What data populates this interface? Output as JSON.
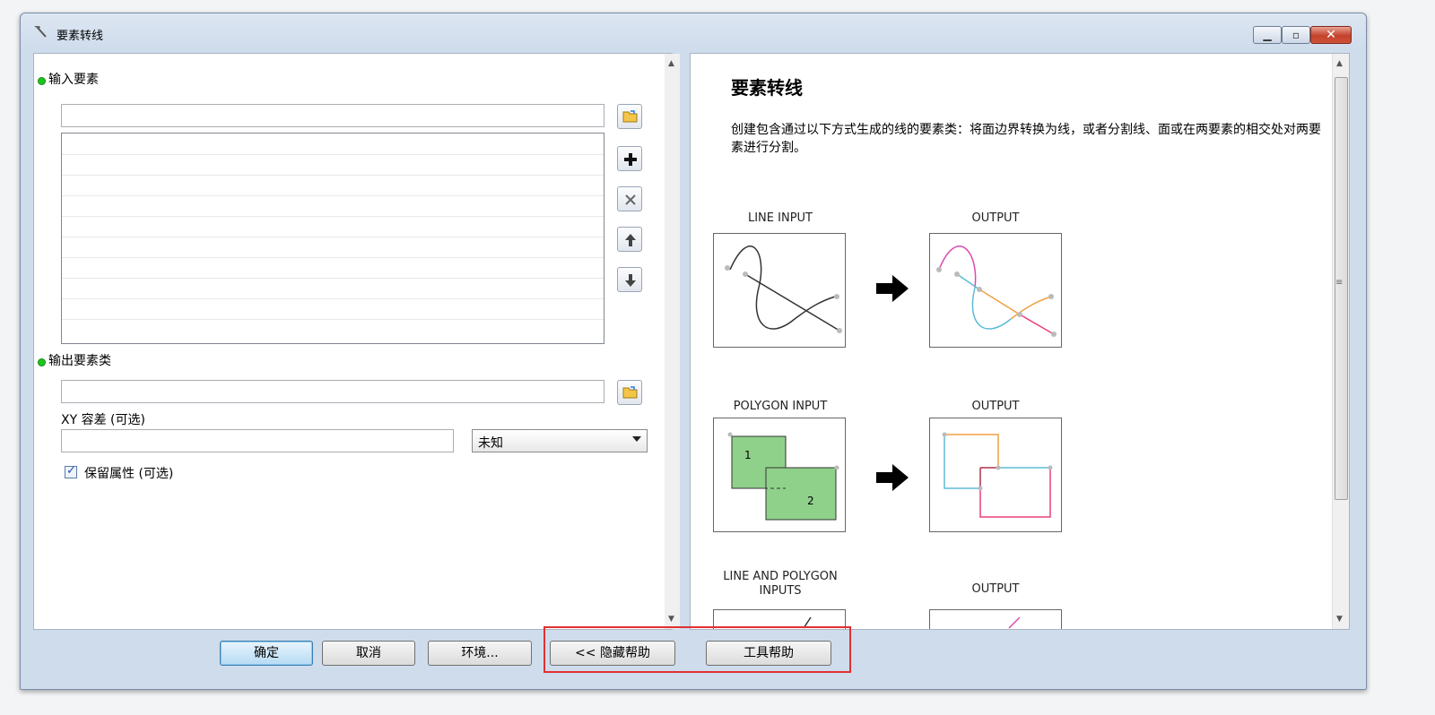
{
  "window": {
    "title": "要素转线"
  },
  "form": {
    "input_label": "输入要素",
    "input_value": "",
    "output_label": "输出要素类",
    "output_value": "",
    "xy_label": "XY 容差 (可选)",
    "xy_value": "",
    "unit_selected": "未知",
    "preserve_label": "保留属性 (可选)",
    "preserve_checked": true
  },
  "help": {
    "title": "要素转线",
    "description": "创建包含通过以下方式生成的线的要素类：将面边界转换为线，或者分割线、面或在两要素的相交处对两要素进行分割。",
    "figures": [
      {
        "input_caption": "LINE INPUT",
        "output_caption": "OUTPUT"
      },
      {
        "input_caption": "POLYGON INPUT",
        "output_caption": "OUTPUT"
      },
      {
        "input_caption_line1": "LINE AND POLYGON",
        "input_caption_line2": "INPUTS",
        "output_caption": "OUTPUT"
      }
    ],
    "polygon_labels": [
      "1",
      "2"
    ]
  },
  "buttons": {
    "ok": "确定",
    "cancel": "取消",
    "env": "环境...",
    "hide_help": "<< 隐藏帮助",
    "tool_help": "工具帮助"
  },
  "colors": {
    "accent_green": "#1ec41e",
    "highlight": "#e03030",
    "polygon_fill": "#8fd18a"
  }
}
